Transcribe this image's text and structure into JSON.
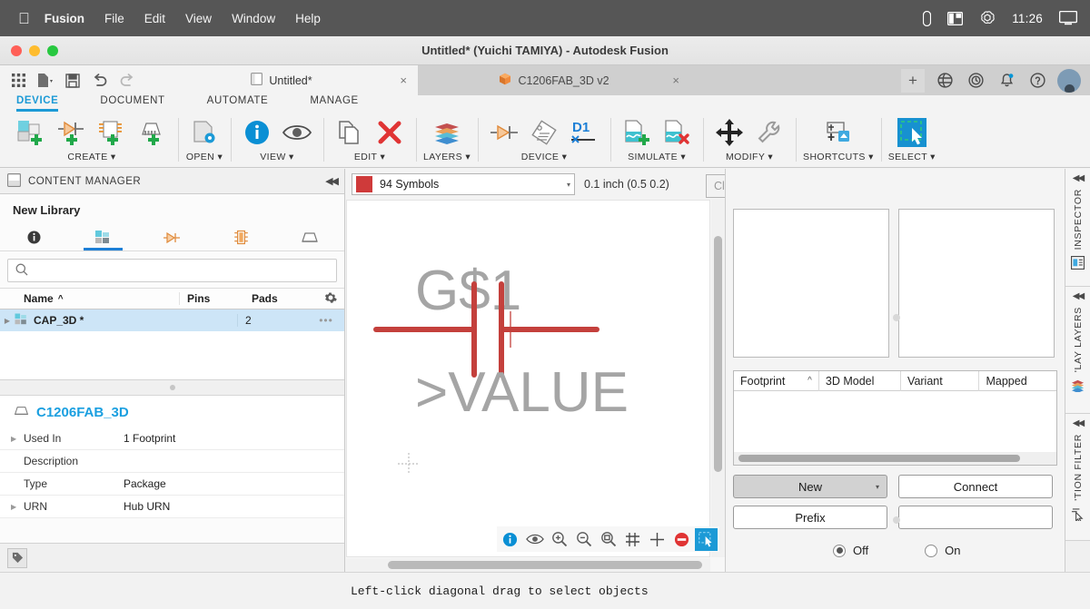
{
  "macbar": {
    "apple_icon": "apple-icon",
    "items": [
      "Fusion",
      "File",
      "Edit",
      "View",
      "Window",
      "Help"
    ],
    "right_icons": [
      "battery-icon",
      "split-view-icon",
      "openai-icon",
      "display-icon"
    ],
    "clock": "11:26"
  },
  "window": {
    "title": "Untitled* (Yuichi TAMIYA) - Autodesk Fusion"
  },
  "tabstrip": {
    "quick_tools": [
      "grid-apps-icon",
      "new-document-icon",
      "save-icon",
      "undo-icon",
      "redo-icon"
    ],
    "tabs": [
      {
        "label": "Untitled*",
        "icon": "document-icon",
        "active": true,
        "close": "×"
      },
      {
        "label": "C1206FAB_3D v2",
        "icon": "package-cube-icon",
        "active": false,
        "close": "×"
      }
    ],
    "add_tab": "+",
    "right_icons": [
      "help-globe-icon",
      "recent-clock-icon",
      "notifications-bell-icon",
      "help-question-icon",
      "account-avatar-icon"
    ]
  },
  "ribbon": {
    "tabs": [
      {
        "label": "DEVICE",
        "active": true
      },
      {
        "label": "DOCUMENT",
        "active": false
      },
      {
        "label": "AUTOMATE",
        "active": false
      },
      {
        "label": "MANAGE",
        "active": false
      }
    ],
    "groups": [
      {
        "label": "CREATE ▾",
        "icons": [
          "new-package-icon",
          "new-symbol-icon",
          "new-device-icon",
          "new-3dpackage-icon"
        ]
      },
      {
        "label": "OPEN ▾",
        "icons": [
          "open-document-icon"
        ]
      },
      {
        "label": "VIEW ▾",
        "icons": [
          "info-icon",
          "visibility-eye-icon"
        ]
      },
      {
        "label": "EDIT ▾",
        "icons": [
          "copy-icon",
          "delete-x-icon"
        ]
      },
      {
        "label": "LAYERS ▾",
        "icons": [
          "layers-stack-icon"
        ]
      },
      {
        "label": "DEVICE ▾",
        "icons": [
          "symbol-pin-icon",
          "tag-attribute-icon",
          "prefix-d1-icon"
        ]
      },
      {
        "label": "SIMULATE ▾",
        "icons": [
          "add-simulation-icon",
          "remove-simulation-icon"
        ]
      },
      {
        "label": "MODIFY ▾",
        "icons": [
          "move-arrows-icon",
          "wrench-tool-icon"
        ]
      },
      {
        "label": "SHORTCUTS ▾",
        "icons": [
          "keyboard-shortcut-icon"
        ]
      },
      {
        "label": "SELECT ▾",
        "icons": [
          "select-marquee-icon"
        ]
      }
    ]
  },
  "left_panel": {
    "header_title": "CONTENT MANAGER",
    "header_icon": "panel-icon",
    "collapse_icon": "collapse-left-icon",
    "library_name": "New Library",
    "tabs": [
      {
        "name": "info-tab",
        "icon": "info-filled-icon",
        "active": false
      },
      {
        "name": "packages-tab",
        "icon": "packages-blocks-icon",
        "active": true
      },
      {
        "name": "symbols-tab",
        "icon": "symbol-diode-icon",
        "active": false
      },
      {
        "name": "devices-tab",
        "icon": "device-chip-icon",
        "active": false
      },
      {
        "name": "packages3d-tab",
        "icon": "package-3d-icon",
        "active": false
      }
    ],
    "search_placeholder": "",
    "search_value": "",
    "search_icon": "search-icon",
    "table": {
      "columns": [
        "Name",
        "Pins",
        "Pads"
      ],
      "sort_indicator": "^",
      "gear_icon": "settings-gear-icon",
      "rows": [
        {
          "name": "CAP_3D *",
          "pins": "2",
          "pads": "",
          "icon": "package-blocks-icon",
          "more": "•••",
          "selected": true
        }
      ]
    },
    "detail": {
      "title": "C1206FAB_3D",
      "title_icon": "package-3d-icon",
      "rows": [
        {
          "key": "Used In",
          "value": "1 Footprint",
          "expandable": true
        },
        {
          "key": "Description",
          "value": "",
          "expandable": false
        },
        {
          "key": "Type",
          "value": "Package",
          "expandable": false
        },
        {
          "key": "URN",
          "value": "Hub URN",
          "expandable": true
        }
      ]
    },
    "footer_icon": "tag-icon"
  },
  "center": {
    "layer_selector": {
      "value": "94 Symbols",
      "color": "#cf3a3a",
      "arrow": "▾"
    },
    "coordinates": "0.1 inch (0.5 0.2)",
    "command_line_placeholder": "Click or press / to activate command line mode",
    "command_line_value": "",
    "command_line_arrow": "▾",
    "canvas": {
      "symbol_name_label": "G$1",
      "symbol_value_label": ">VALUE",
      "symbol_color": "#c4403c",
      "origin_marker": "origin-crosshair"
    },
    "tools": [
      {
        "name": "info-tool",
        "icon": "info-icon",
        "selected": false
      },
      {
        "name": "visibility-tool",
        "icon": "eye-icon",
        "selected": false
      },
      {
        "name": "zoom-in-tool",
        "icon": "zoom-in-icon",
        "selected": false
      },
      {
        "name": "zoom-out-tool",
        "icon": "zoom-out-icon",
        "selected": false
      },
      {
        "name": "zoom-fit-tool",
        "icon": "zoom-fit-icon",
        "selected": false
      },
      {
        "name": "grid-tool",
        "icon": "grid-icon",
        "selected": false
      },
      {
        "name": "crosshair-tool",
        "icon": "crosshair-icon",
        "selected": false
      },
      {
        "name": "stop-tool",
        "icon": "stop-icon",
        "selected": false
      },
      {
        "name": "select-tool",
        "icon": "select-marquee-icon",
        "selected": true
      }
    ]
  },
  "right_panel": {
    "preview_left": "symbol-preview",
    "preview_right": "package-preview",
    "footprint_table": {
      "columns": [
        "Footprint",
        "3D Model",
        "Variant",
        "Mapped"
      ],
      "sort_indicator": "^",
      "rows": []
    },
    "buttons": {
      "new": "New",
      "new_arrow": "▾",
      "connect": "Connect",
      "prefix": "Prefix",
      "prefix_value": ""
    },
    "radios": [
      {
        "label": "Off",
        "checked": true
      },
      {
        "label": "On",
        "checked": false
      }
    ]
  },
  "edge_tabs": [
    {
      "label": "INSPECTOR",
      "icon": "inspector-icon",
      "collapse": "collapse-icon"
    },
    {
      "label": "'LAY LAYERS",
      "icon": "layers-stack-icon",
      "collapse": "collapse-icon"
    },
    {
      "label": "'TION FILTER",
      "icon": "selection-filter-icon",
      "collapse": "collapse-icon"
    }
  ],
  "status_bar": {
    "message": "Left-click diagonal drag to select objects"
  }
}
